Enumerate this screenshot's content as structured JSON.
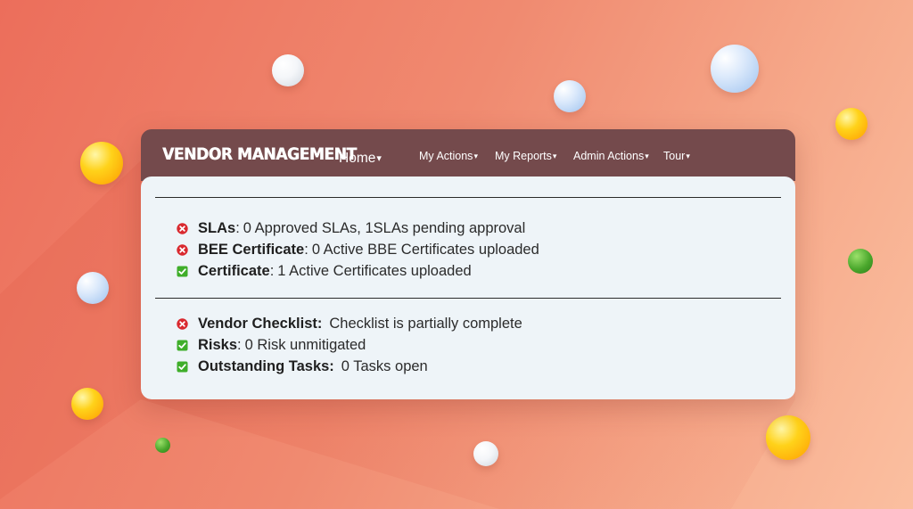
{
  "colors": {
    "navbar": "#744a4c",
    "panel": "#eef4f8",
    "ok": "#3fae2a",
    "fail": "#d9292f"
  },
  "navbar": {
    "brand": "VENDOR MANAGEMENT",
    "home_label": "Home",
    "items": [
      {
        "label": "My Actions"
      },
      {
        "label": "My Reports"
      },
      {
        "label": "Admin Actions"
      },
      {
        "label": "Tour"
      }
    ],
    "caret": "▾"
  },
  "sections": [
    {
      "rows": [
        {
          "status": "fail",
          "icon": "x-circle-icon",
          "label": "SLAs",
          "sep": ":",
          "text": "0 Approved SLAs, 1SLAs pending approval"
        },
        {
          "status": "fail",
          "icon": "x-circle-icon",
          "label": "BEE Certificate",
          "sep": ":",
          "text": "0 Active BBE Certificates uploaded"
        },
        {
          "status": "ok",
          "icon": "checkbox-check-icon",
          "label": "Certificate",
          "sep": ":",
          "text": "1 Active Certificates uploaded"
        }
      ]
    },
    {
      "rows": [
        {
          "status": "fail",
          "icon": "x-circle-icon",
          "label": "Vendor Checklist:",
          "sep": "",
          "text": "Checklist is partially complete"
        },
        {
          "status": "ok",
          "icon": "checkbox-check-icon",
          "label": "Risks",
          "sep": ":",
          "text": "0 Risk unmitigated"
        },
        {
          "status": "ok",
          "icon": "checkbox-check-icon",
          "label": "Outstanding Tasks:",
          "sep": "",
          "text": "0 Tasks open"
        }
      ]
    }
  ]
}
